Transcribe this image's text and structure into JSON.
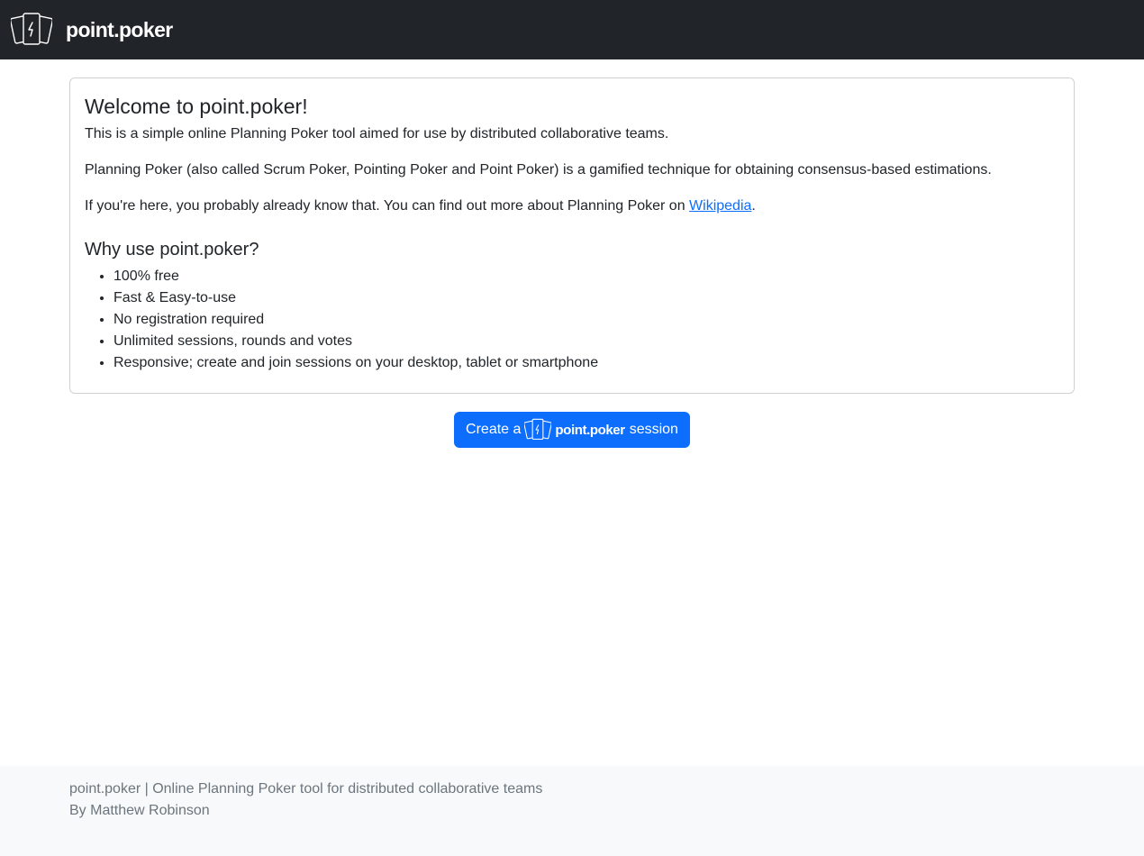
{
  "navbar": {
    "brand_text": "point.poker",
    "brand_icon": "cards-icon"
  },
  "card": {
    "title": "Welcome to point.poker!",
    "intro": "This is a simple online Planning Poker tool aimed for use by distributed collaborative teams.",
    "definition": "Planning Poker (also called Scrum Poker, Pointing Poker and Point Poker) is a gamified technique for obtaining consensus-based estimations.",
    "more_prefix": "If you're here, you probably already know that. You can find out more about Planning Poker on ",
    "more_link": "Wikipedia",
    "more_suffix": ".",
    "why_title": "Why use point.poker?",
    "reasons": [
      "100% free",
      "Fast & Easy-to-use",
      "No registration required",
      "Unlimited sessions, rounds and votes",
      "Responsive; create and join sessions on your desktop, tablet or smartphone"
    ]
  },
  "cta": {
    "prefix": "Create a",
    "brand_text": "point.poker",
    "suffix": "session"
  },
  "footer": {
    "tagline": "point.poker | Online Planning Poker tool for distributed collaborative teams",
    "author": "By Matthew Robinson"
  },
  "colors": {
    "navbar_bg": "#212529",
    "primary": "#0d6efd",
    "footer_bg": "#f8f9fa",
    "muted_text": "#6c757d"
  }
}
